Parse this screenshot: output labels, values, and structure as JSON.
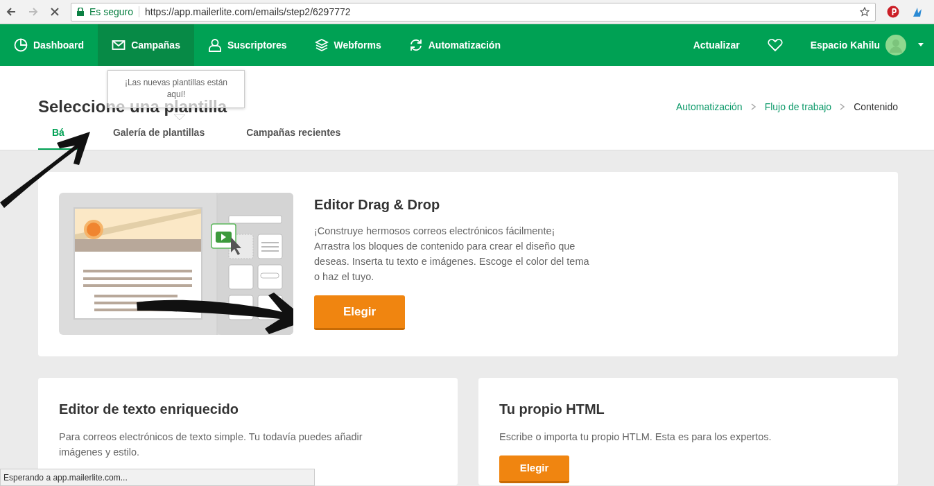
{
  "browser": {
    "security": "Es seguro",
    "url": "https://app.mailerlite.com/emails/step2/6297772"
  },
  "nav": {
    "items": [
      {
        "label": "Dashboard",
        "selected": false
      },
      {
        "label": "Campañas",
        "selected": true
      },
      {
        "label": "Suscriptores",
        "selected": false
      },
      {
        "label": "Webforms",
        "selected": false
      },
      {
        "label": "Automatización",
        "selected": false
      }
    ],
    "upgrade": "Actualizar",
    "account": "Espacio Kahilu"
  },
  "header": {
    "title": "Seleccione una plantilla",
    "tooltip": "¡Las nuevas plantillas están aquí!",
    "breadcrumb": [
      {
        "label": "Automatización",
        "link": true
      },
      {
        "label": "Flujo de trabajo",
        "link": true
      },
      {
        "label": "Contenido",
        "link": false
      }
    ],
    "tabs": [
      {
        "label": "Bá",
        "selected": true
      },
      {
        "label": "Galería de plantillas",
        "selected": false
      },
      {
        "label": "Campañas recientes",
        "selected": false
      }
    ]
  },
  "editors": [
    {
      "title": "Editor Drag & Drop",
      "text": "¡Construye hermosos correos electrónicos fácilmente¡ Arrastra los bloques de contenido para crear el diseño que deseas. Inserta tu texto e imágenes. Escoge el color del tema o haz el tuyo.",
      "button": "Elegir"
    },
    {
      "title": "Editor de texto enriquecido",
      "text": "Para correos electrónicos de texto simple. Tu todavía puedes añadir imágenes y estilo."
    },
    {
      "title": "Tu propio HTML",
      "text": "Escribe o importa tu propio HTLM. Esta es para los expertos.",
      "button": "Elegir"
    }
  ],
  "status_bar": "Esperando a app.mailerlite.com..."
}
